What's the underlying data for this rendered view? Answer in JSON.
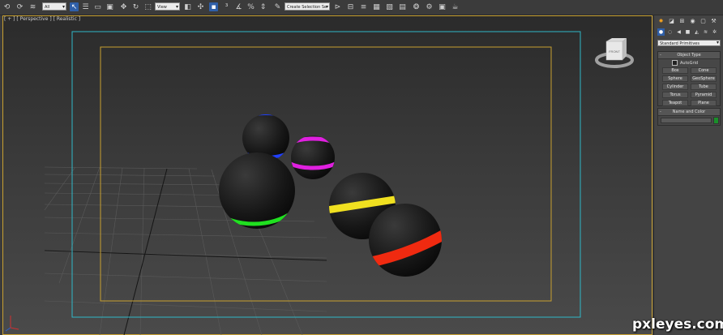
{
  "toolbar": {
    "selection_filter": "All",
    "reference_coord": "View",
    "named_selection": "Create Selection Se",
    "icons": [
      "undo-icon",
      "redo-icon",
      "link-icon",
      "unlink-icon",
      "bind-space-warp-icon",
      "select-object-icon",
      "select-by-name-icon",
      "rectangular-selection-icon",
      "window-crossing-icon",
      "move-icon",
      "rotate-icon",
      "scale-icon",
      "pivot-icon",
      "select-manipulate-icon",
      "keyboard-shortcut-icon",
      "snap-toggle-icon",
      "angle-snap-icon",
      "percent-snap-icon",
      "spinner-snap-icon",
      "edit-named-selection-icon",
      "mirror-icon",
      "align-icon",
      "layer-manager-icon",
      "graphite-tools-icon",
      "curve-editor-icon",
      "schematic-view-icon",
      "material-editor-icon",
      "render-setup-icon",
      "rendered-frame-icon",
      "render-icon"
    ]
  },
  "viewport": {
    "label": "[ + ] [ Perspective ] [ Realistic ]",
    "viewcube_label": "FRONT",
    "background_top": "#2b2b2b",
    "background_bottom": "#4a4a4a",
    "safe_frame_color": "#2fb8c8",
    "action_safe_color": "#c8a030",
    "spheres": [
      {
        "band_color": "#2040ff"
      },
      {
        "band_color": "#e020e0"
      },
      {
        "band_color": "#20e020"
      },
      {
        "band_color": "#f0e020"
      },
      {
        "band_color": "#f02a10"
      }
    ]
  },
  "command_panel": {
    "primitive_type": "Standard Primitives",
    "object_type_title": "Object Type",
    "autogrid_label": "AutoGrid",
    "buttons": [
      "Box",
      "Cone",
      "Sphere",
      "GeoSphere",
      "Cylinder",
      "Tube",
      "Torus",
      "Pyramid",
      "Teapot",
      "Plane"
    ],
    "name_color_title": "Name and Color",
    "swatch_color": "#1a8f2a"
  },
  "watermark": "pxleyes.com"
}
